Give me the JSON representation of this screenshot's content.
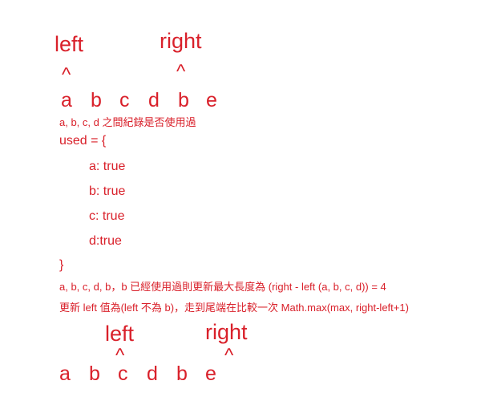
{
  "colors": {
    "text": "#d9202a",
    "background": "#ffffff"
  },
  "step1": {
    "left_label": "left",
    "right_label": "right",
    "caret": "^",
    "chars": [
      "a",
      "b",
      "c",
      "d",
      "b",
      "e"
    ]
  },
  "explanation": {
    "used_note": "a, b, c, d 之間紀錄是否使用過",
    "used_open": "used = {",
    "used_entries": [
      "a: true",
      "b: true",
      "c: true",
      "d:true"
    ],
    "used_close": "}",
    "line1": "a, b, c, d, b，b 已經使用過則更新最大長度為 (right - left (a, b, c, d)) = 4",
    "line2": "更新 left 值為(left 不為 b)，走到尾端在比較一次 Math.max(max, right-left+1)"
  },
  "step2": {
    "left_label": "left",
    "right_label": "right",
    "caret": "^",
    "chars": [
      "a",
      "b",
      "c",
      "d",
      "b",
      "e"
    ]
  }
}
